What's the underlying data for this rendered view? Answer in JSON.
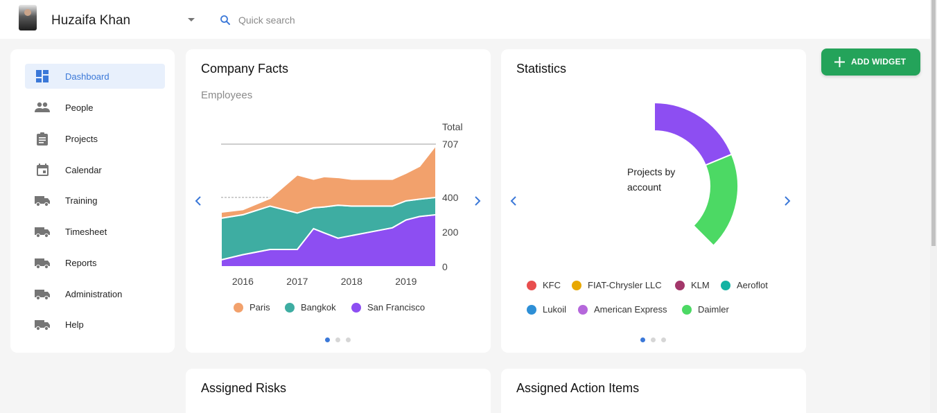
{
  "header": {
    "user_name": "Huzaifa Khan",
    "search_placeholder": "Quick search"
  },
  "sidebar": {
    "items": [
      {
        "label": "Dashboard",
        "icon": "dashboard-icon",
        "active": true
      },
      {
        "label": "People",
        "icon": "people-icon"
      },
      {
        "label": "Projects",
        "icon": "clipboard-icon"
      },
      {
        "label": "Calendar",
        "icon": "calendar-icon"
      },
      {
        "label": "Training",
        "icon": "truck-icon"
      },
      {
        "label": "Timesheet",
        "icon": "truck-icon"
      },
      {
        "label": "Reports",
        "icon": "truck-icon"
      },
      {
        "label": "Administration",
        "icon": "truck-icon"
      },
      {
        "label": "Help",
        "icon": "truck-icon"
      }
    ]
  },
  "actions": {
    "add_widget_label": "ADD WIDGET"
  },
  "company_facts": {
    "title": "Company Facts",
    "subtitle": "Employees",
    "axis_title": "Total",
    "y_ticks": [
      "707",
      "400",
      "200",
      "0"
    ],
    "x_ticks": [
      "2016",
      "2017",
      "2018",
      "2019"
    ],
    "legend": [
      "Paris",
      "Bangkok",
      "San Francisco"
    ]
  },
  "statistics": {
    "title": "Statistics",
    "center_label_line1": "Projects by",
    "center_label_line2": "account",
    "legend": [
      "KFC",
      "FIAT-Chrysler LLC",
      "KLM",
      "Aeroflot",
      "Lukoil",
      "American Express",
      "Daimler"
    ]
  },
  "assigned_risks": {
    "title": "Assigned Risks"
  },
  "assigned_action_items": {
    "title": "Assigned Action Items"
  },
  "colors": {
    "accent": "#3b78d8",
    "add_widget": "#24a35a",
    "paris": "#f2a16c",
    "bangkok": "#3eada2",
    "san_francisco": "#8d4ef2",
    "kfc": "#e84e4e",
    "fiat": "#e8a800",
    "klm": "#a3376a",
    "aeroflot": "#14b3a3",
    "lukoil": "#2e8fd6",
    "amex": "#b567db",
    "daimler": "#4cd964"
  },
  "chart_data": [
    {
      "type": "area",
      "title": "Employees",
      "ylabel": "Total",
      "stacked": true,
      "x": [
        2015.6,
        2016.0,
        2016.5,
        2017.0,
        2017.3,
        2017.5,
        2017.75,
        2018.0,
        2018.25,
        2018.5,
        2018.75,
        2019.0,
        2019.25,
        2019.55
      ],
      "series": [
        {
          "name": "San Francisco",
          "values": [
            40,
            70,
            100,
            100,
            220,
            195,
            165,
            180,
            195,
            210,
            225,
            270,
            290,
            300
          ]
        },
        {
          "name": "Bangkok",
          "values": [
            240,
            230,
            250,
            210,
            120,
            150,
            190,
            170,
            155,
            140,
            125,
            110,
            100,
            100
          ]
        },
        {
          "name": "Paris",
          "values": [
            35,
            30,
            45,
            220,
            165,
            175,
            160,
            155,
            155,
            155,
            155,
            160,
            190,
            300
          ]
        }
      ],
      "ylim": [
        0,
        707
      ],
      "y_ticks": [
        0,
        200,
        400,
        707
      ],
      "x_ticks": [
        2016,
        2017,
        2018,
        2019
      ],
      "legend": "bottom"
    },
    {
      "type": "pie",
      "title": "Projects by account",
      "donut": true,
      "labels": [
        "KFC",
        "FIAT-Chrysler LLC",
        "KLM",
        "Aeroflot",
        "Lukoil",
        "American Express",
        "Daimler"
      ],
      "values": [
        0,
        0,
        0,
        0,
        0,
        1,
        1
      ],
      "legend": "bottom"
    }
  ]
}
